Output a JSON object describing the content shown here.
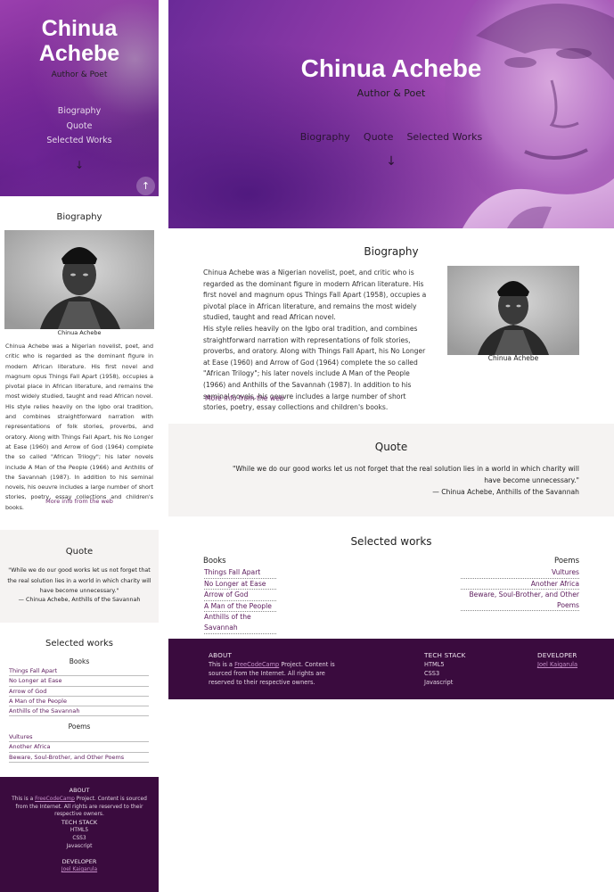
{
  "site": {
    "name": "Chinua Achebe",
    "subtitle": "Author & Poet",
    "nav": [
      "Biography",
      "Quote",
      "Selected Works"
    ],
    "down_arrow": "↓",
    "up_arrow": "↑"
  },
  "biography": {
    "title": "Biography",
    "photo_caption": "Chinua Achebe",
    "paragraph1": "Chinua Achebe was a Nigerian novelist, poet, and critic who is regarded as the dominant figure in modern African literature. His first novel and magnum opus Things Fall Apart (1958), occupies a pivotal place in African literature, and remains the most widely studied, taught and read African novel.",
    "paragraph2": "His style relies heavily on the Igbo oral tradition, and combines straightforward narration with representations of folk stories, proverbs, and oratory. Along with Things Fall Apart, his No Longer at Ease (1960) and Arrow of God (1964) complete the so called \"African Trilogy\"; his later novels include A Man of the People (1966) and Anthills of the Savannah (1987). In addition to his seminal novels, his oeuvre includes a large number of short stories, poetry, essay collections and children's books.",
    "more_link": "More info from the web"
  },
  "quote": {
    "title": "Quote",
    "text": "\"While we do our good works let us not forget that the real solution lies in a world in which charity will have become unnecessary.\"",
    "cite": "— Chinua Achebe, Anthills of the Savannah"
  },
  "works": {
    "title": "Selected works",
    "books_heading": "Books",
    "poems_heading": "Poems",
    "books": [
      "Things Fall Apart",
      "No Longer at Ease",
      "Arrow of God",
      "A Man of the People",
      "Anthills of the Savannah"
    ],
    "poems": [
      "Vultures",
      "Another Africa",
      "Beware, Soul-Brother, and Other Poems"
    ]
  },
  "footer": {
    "about_heading": "ABOUT",
    "about_prefix": "This is a ",
    "about_link": "FreeCodeCamp",
    "about_suffix": " Project. Content is sourced from the Internet. All rights are reserved to their respective owners.",
    "tech_heading": "TECH STACK",
    "tech": [
      "HTML5",
      "CSS3",
      "Javascript"
    ],
    "dev_heading": "DEVELOPER",
    "dev_name": "Joel Kaigarula"
  },
  "colors": {
    "hero_purple": "#8d3aa8",
    "footer_bg": "#3a0b3e",
    "link": "#5b1a5b",
    "quote_bg": "#f5f3f2"
  }
}
